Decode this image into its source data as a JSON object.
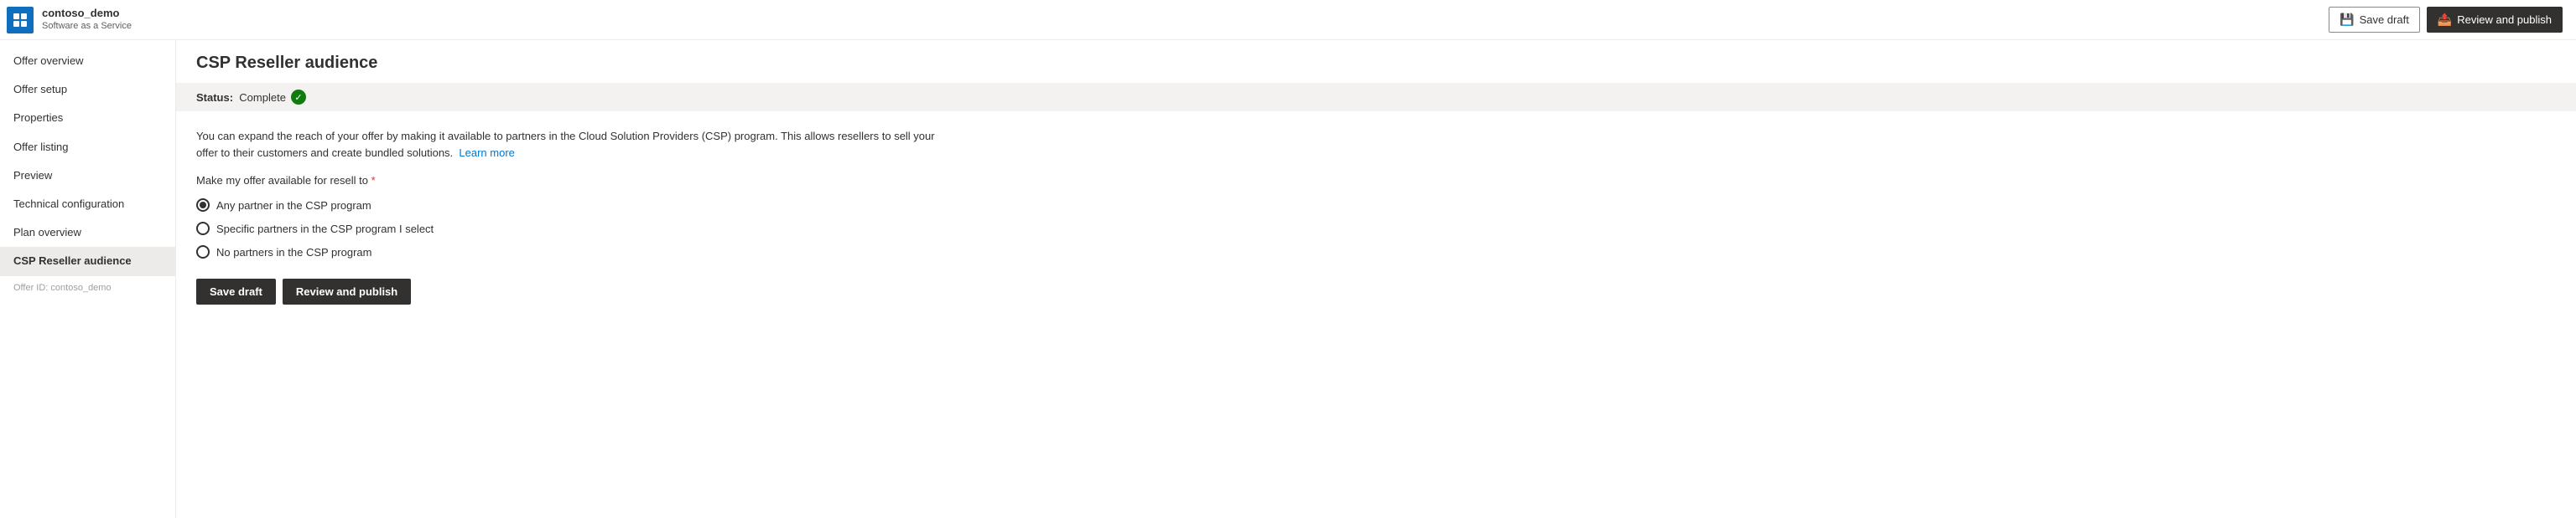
{
  "app": {
    "name": "contoso_demo",
    "subtitle": "Software as a Service",
    "icon_label": "marketplace-icon"
  },
  "header": {
    "save_draft_label": "Save draft",
    "review_publish_label": "Review and publish"
  },
  "sidebar": {
    "items": [
      {
        "id": "offer-overview",
        "label": "Offer overview",
        "active": false,
        "disabled": false
      },
      {
        "id": "offer-setup",
        "label": "Offer setup",
        "active": false,
        "disabled": false
      },
      {
        "id": "properties",
        "label": "Properties",
        "active": false,
        "disabled": false
      },
      {
        "id": "offer-listing",
        "label": "Offer listing",
        "active": false,
        "disabled": false
      },
      {
        "id": "preview",
        "label": "Preview",
        "active": false,
        "disabled": false
      },
      {
        "id": "technical-configuration",
        "label": "Technical configuration",
        "active": false,
        "disabled": false
      },
      {
        "id": "plan-overview",
        "label": "Plan overview",
        "active": false,
        "disabled": false
      },
      {
        "id": "csp-reseller-audience",
        "label": "CSP Reseller audience",
        "active": true,
        "disabled": false
      }
    ],
    "offer_id_label": "Offer ID: contoso_demo"
  },
  "page": {
    "title": "CSP Reseller audience",
    "status_prefix": "Status:",
    "status_value": "Complete",
    "description": "You can expand the reach of your offer by making it available to partners in the Cloud Solution Providers (CSP) program. This allows resellers to sell your offer to their customers and create bundled solutions.",
    "learn_more_label": "Learn more",
    "section_label": "Make my offer available for resell to",
    "radio_options": [
      {
        "id": "any-partner",
        "label": "Any partner in the CSP program",
        "selected": true
      },
      {
        "id": "specific-partners",
        "label": "Specific partners in the CSP program I select",
        "selected": false
      },
      {
        "id": "no-partners",
        "label": "No partners in the CSP program",
        "selected": false
      }
    ],
    "save_draft_label": "Save draft",
    "review_publish_label": "Review and publish"
  }
}
